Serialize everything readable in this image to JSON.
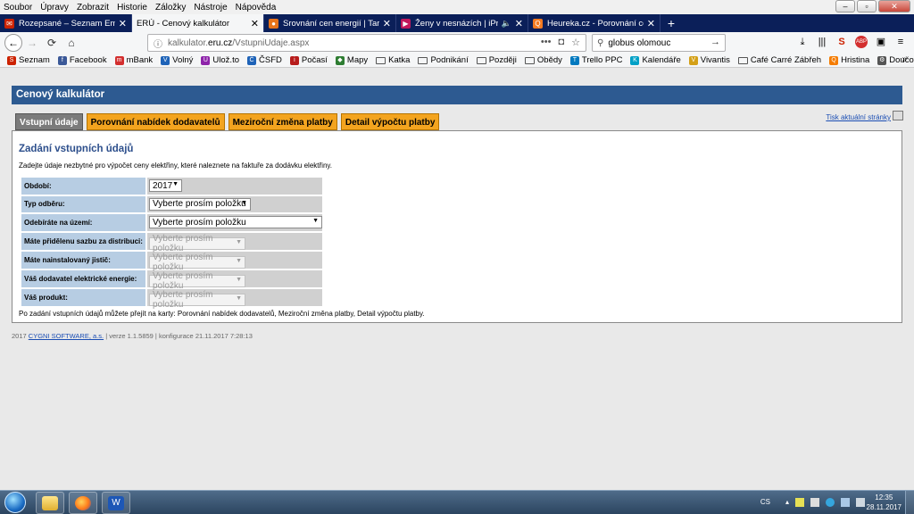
{
  "menu": [
    "Soubor",
    "Úpravy",
    "Zobrazit",
    "Historie",
    "Záložky",
    "Nástroje",
    "Nápověda"
  ],
  "tabs": [
    {
      "title": "Rozepsané – Seznam Email",
      "icon_color": "#cc2200",
      "icon_glyph": "✉"
    },
    {
      "title": "ERÚ - Cenový kalkulátor",
      "icon_color": "",
      "icon_glyph": ""
    },
    {
      "title": "Srovnání cen energií | Tarifoma",
      "icon_color": "#e8731a",
      "icon_glyph": "●"
    },
    {
      "title": "Ženy v nesnázích | iPrima",
      "icon_color": "#c2185b",
      "icon_glyph": "▶"
    },
    {
      "title": "Heureka.cz - Porovnání cen a sl",
      "icon_color": "#f47a20",
      "icon_glyph": "Q"
    }
  ],
  "active_tab_index": 1,
  "url": {
    "host_prefix": "kalkulator.",
    "host": "eru.cz",
    "path": "/VstupniUdaje.aspx"
  },
  "search": {
    "value": "globus olomouc"
  },
  "bookmarks": [
    {
      "label": "Seznam",
      "color": "#cc2200",
      "glyph": "S"
    },
    {
      "label": "Facebook",
      "color": "#3b5998",
      "glyph": "f"
    },
    {
      "label": "mBank",
      "color": "#d32f2f",
      "glyph": "m"
    },
    {
      "label": "Volný",
      "color": "#1e63b8",
      "glyph": "V"
    },
    {
      "label": "Ulož.to",
      "color": "#8e24aa",
      "glyph": "U"
    },
    {
      "label": "ČSFD",
      "color": "#1e63b8",
      "glyph": "Č"
    },
    {
      "label": "Počasí",
      "color": "#b71c1c",
      "glyph": "i"
    },
    {
      "label": "Mapy",
      "color": "#2e7d32",
      "glyph": "◆"
    },
    {
      "label": "Katka",
      "folder": true
    },
    {
      "label": "Podnikání",
      "folder": true
    },
    {
      "label": "Později",
      "folder": true
    },
    {
      "label": "Obědy",
      "folder": true
    },
    {
      "label": "Trello PPC",
      "color": "#0079bf",
      "glyph": "T"
    },
    {
      "label": "Kalendáře",
      "color": "#00a0c6",
      "glyph": "K"
    },
    {
      "label": "Vivantis",
      "color": "#d4a017",
      "glyph": "V"
    },
    {
      "label": "Café Carré Zábřeh",
      "folder": true
    },
    {
      "label": "Hristina",
      "color": "#f57c00",
      "glyph": "Q"
    },
    {
      "label": "Doučování",
      "color": "#555555",
      "glyph": "⚙"
    }
  ],
  "app": {
    "header": "Cenový kalkulátor",
    "tabs": [
      "Vstupní údaje",
      "Porovnání nabídek dodavatelů",
      "Meziroční změna platby",
      "Detail výpočtu platby"
    ],
    "print_link": "Tisk aktuální stránky",
    "section_title": "Zadání vstupních údajů",
    "intro": "Zadejte údaje nezbytné pro výpočet ceny elektřiny, které naleznete na faktuře za dodávku elektřiny.",
    "fields": [
      {
        "label": "Období:",
        "value": "2017",
        "width": "narrow",
        "disabled": false
      },
      {
        "label": "Typ odběru:",
        "value": "Vyberte prosím položku",
        "width": "medium",
        "disabled": false
      },
      {
        "label": "Odebíráte na území:",
        "value": "Vyberte prosím položku",
        "width": "wide",
        "disabled": false
      },
      {
        "label": "Máte přidělenu sazbu za distribuci:",
        "value": "Vyberte prosím položku",
        "width": "small",
        "disabled": true
      },
      {
        "label": "Máte nainstalovaný jistič:",
        "value": "Vyberte prosím položku",
        "width": "small",
        "disabled": true
      },
      {
        "label": "Váš dodavatel elektrické energie:",
        "value": "Vyberte prosím položku",
        "width": "small",
        "disabled": true
      },
      {
        "label": "Váš produkt:",
        "value": "Vyberte prosím položku",
        "width": "small",
        "disabled": true
      }
    ],
    "note": "Po zadání vstupních údajů můžete přejít na karty: Porovnání nabídek dodavatelů, Meziroční změna platby, Detail výpočtu platby.",
    "footer": {
      "year": "2017",
      "company": "CYGNI SOFTWARE, a.s.",
      "rest": " | verze 1.1.5859 | konfigurace 21.11.2017 7:28:13"
    }
  },
  "taskbar": {
    "lang": "CS",
    "time": "12:35",
    "date": "28.11.2017"
  },
  "colors": {
    "header_blue": "#2d5a91",
    "tab_orange": "#f3a41f",
    "label_blue": "#b7cde3",
    "title_blue": "#2d4f8c"
  }
}
